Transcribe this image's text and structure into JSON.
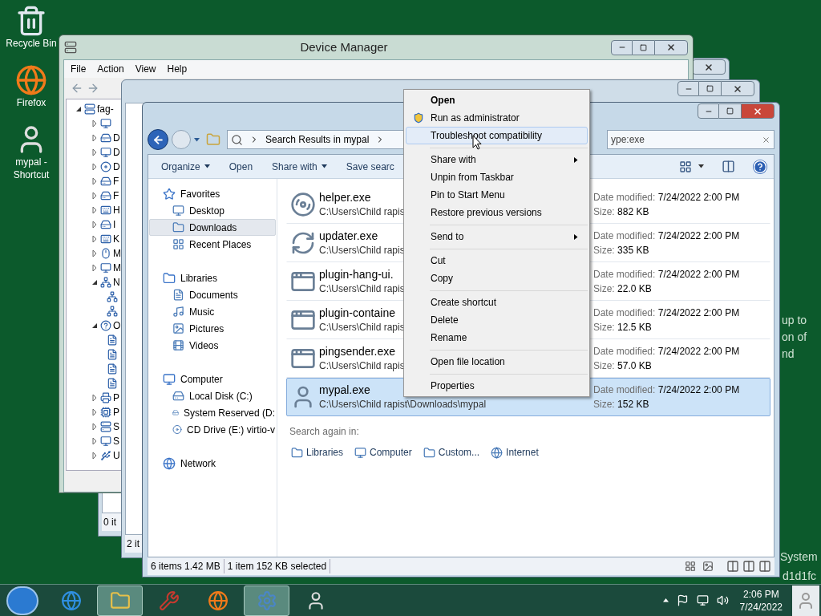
{
  "desktop_icons": [
    {
      "label": "Recycle Bin"
    },
    {
      "label": "Firefox"
    },
    {
      "label": "mypal - Shortcut"
    }
  ],
  "device_manager": {
    "title": "Device Manager",
    "menu": [
      "File",
      "Action",
      "View",
      "Help"
    ],
    "tree": {
      "label": "fag-",
      "expanded": true,
      "children": [
        {
          "expanded": false
        },
        {
          "label": "D",
          "expanded": false
        },
        {
          "label": "D",
          "expanded": false
        },
        {
          "label": "D",
          "expanded": false
        },
        {
          "label": "F",
          "expanded": false
        },
        {
          "label": "F",
          "expanded": false
        },
        {
          "label": "H",
          "expanded": false
        },
        {
          "label": "I",
          "expanded": false
        },
        {
          "label": "K",
          "expanded": false
        },
        {
          "label": "M",
          "expanded": false
        },
        {
          "label": "M",
          "expanded": false
        },
        {
          "label": "N",
          "expanded": true,
          "children": [
            {
              "kind": "device"
            },
            {
              "kind": "device"
            }
          ]
        },
        {
          "label": "O",
          "expanded": true,
          "children": [
            {
              "kind": "device"
            },
            {
              "kind": "device"
            },
            {
              "kind": "device"
            },
            {
              "kind": "device"
            }
          ]
        },
        {
          "label": "P",
          "expanded": false
        },
        {
          "label": "P",
          "expanded": false
        },
        {
          "label": "S",
          "expanded": false
        },
        {
          "label": "S",
          "expanded": false
        },
        {
          "label": "U",
          "expanded": false
        }
      ]
    }
  },
  "background_windows": [
    {
      "status": "0 it"
    },
    {
      "status": "2 it"
    }
  ],
  "explorer": {
    "address": "Search Results in mypal",
    "search_value": "ype:exe",
    "toolbar": [
      {
        "label": "Organize",
        "dropdown": true
      },
      {
        "label": "Open",
        "dropdown": false
      },
      {
        "label": "Share with",
        "dropdown": true
      },
      {
        "label": "Save searc",
        "dropdown": false
      }
    ],
    "nav": [
      {
        "label": "Favorites",
        "children": [
          {
            "label": "Desktop",
            "selected": false
          },
          {
            "label": "Downloads",
            "selected": true
          },
          {
            "label": "Recent Places",
            "selected": false
          }
        ]
      },
      {
        "label": "Libraries",
        "children": [
          {
            "label": "Documents",
            "selected": false
          },
          {
            "label": "Music",
            "selected": false
          },
          {
            "label": "Pictures",
            "selected": false
          },
          {
            "label": "Videos",
            "selected": false
          }
        ]
      },
      {
        "label": "Computer",
        "children": [
          {
            "label": "Local Disk (C:)",
            "selected": false
          },
          {
            "label": "System Reserved (D:",
            "selected": false
          },
          {
            "label": "CD Drive (E:) virtio-v",
            "selected": false
          }
        ]
      },
      {
        "label": "Network"
      }
    ],
    "files": [
      {
        "name": "helper.exe",
        "path": "C:\\Users\\Child rapis",
        "date_label": "Date modified:",
        "date": "7/24/2022 2:00 PM",
        "size_label": "Size:",
        "size": "882 KB",
        "selected": false
      },
      {
        "name": "updater.exe",
        "path": "C:\\Users\\Child rapis",
        "date_label": "Date modified:",
        "date": "7/24/2022 2:00 PM",
        "size_label": "Size:",
        "size": "335 KB",
        "selected": false
      },
      {
        "name": "plugin-hang-ui.",
        "path": "C:\\Users\\Child rapis",
        "date_label": "Date modified:",
        "date": "7/24/2022 2:00 PM",
        "size_label": "Size:",
        "size": "22.0 KB",
        "selected": false
      },
      {
        "name": "plugin-containe",
        "path": "C:\\Users\\Child rapis",
        "date_label": "Date modified:",
        "date": "7/24/2022 2:00 PM",
        "size_label": "Size:",
        "size": "12.5 KB",
        "selected": false
      },
      {
        "name": "pingsender.exe",
        "path": "C:\\Users\\Child rapis",
        "date_label": "Date modified:",
        "date": "7/24/2022 2:00 PM",
        "size_label": "Size:",
        "size": "57.0 KB",
        "selected": false
      },
      {
        "name": "mypal.exe",
        "path": "C:\\Users\\Child rapist\\Downloads\\mypal",
        "date_label": "Date modified:",
        "date": "7/24/2022 2:00 PM",
        "size_label": "Size:",
        "size": "152 KB",
        "selected": true
      }
    ],
    "search_again": {
      "label": "Search again in:",
      "items": [
        "Libraries",
        "Computer",
        "Custom...",
        "Internet"
      ]
    },
    "status": [
      "6 items 1.42 MB",
      "1 item 152 KB selected"
    ]
  },
  "context_menu": [
    {
      "kind": "item",
      "label": "Open",
      "bold": true,
      "highlighted": false,
      "submenu": false
    },
    {
      "kind": "item",
      "label": "Run as administrator",
      "bold": false,
      "highlighted": false,
      "submenu": false,
      "shield": true
    },
    {
      "kind": "item",
      "label": "Troubleshoot compatibility",
      "bold": false,
      "highlighted": true,
      "submenu": false
    },
    {
      "kind": "separator"
    },
    {
      "kind": "item",
      "label": "Share with",
      "bold": false,
      "highlighted": false,
      "submenu": true
    },
    {
      "kind": "item",
      "label": "Unpin from Taskbar",
      "bold": false,
      "highlighted": false,
      "submenu": false
    },
    {
      "kind": "item",
      "label": "Pin to Start Menu",
      "bold": false,
      "highlighted": false,
      "submenu": false
    },
    {
      "kind": "item",
      "label": "Restore previous versions",
      "bold": false,
      "highlighted": false,
      "submenu": false
    },
    {
      "kind": "separator"
    },
    {
      "kind": "item",
      "label": "Send to",
      "bold": false,
      "highlighted": false,
      "submenu": true
    },
    {
      "kind": "separator"
    },
    {
      "kind": "item",
      "label": "Cut",
      "bold": false,
      "highlighted": false,
      "submenu": false
    },
    {
      "kind": "item",
      "label": "Copy",
      "bold": false,
      "highlighted": false,
      "submenu": false
    },
    {
      "kind": "separator"
    },
    {
      "kind": "item",
      "label": "Create shortcut",
      "bold": false,
      "highlighted": false,
      "submenu": false
    },
    {
      "kind": "item",
      "label": "Delete",
      "bold": false,
      "highlighted": false,
      "submenu": false
    },
    {
      "kind": "item",
      "label": "Rename",
      "bold": false,
      "highlighted": false,
      "submenu": false
    },
    {
      "kind": "separator"
    },
    {
      "kind": "item",
      "label": "Open file location",
      "bold": false,
      "highlighted": false,
      "submenu": false
    },
    {
      "kind": "separator"
    },
    {
      "kind": "item",
      "label": "Properties",
      "bold": false,
      "highlighted": false,
      "submenu": false
    }
  ],
  "desktop_text": [
    "up to",
    "on of",
    "nd",
    "System",
    "d1d1fc"
  ],
  "taskbar": {
    "items": [
      {
        "active": false
      },
      {
        "active": true
      },
      {
        "active": false
      },
      {
        "active": false
      },
      {
        "active": true
      },
      {
        "active": false
      }
    ],
    "time": "2:06 PM",
    "date": "7/24/2022"
  }
}
